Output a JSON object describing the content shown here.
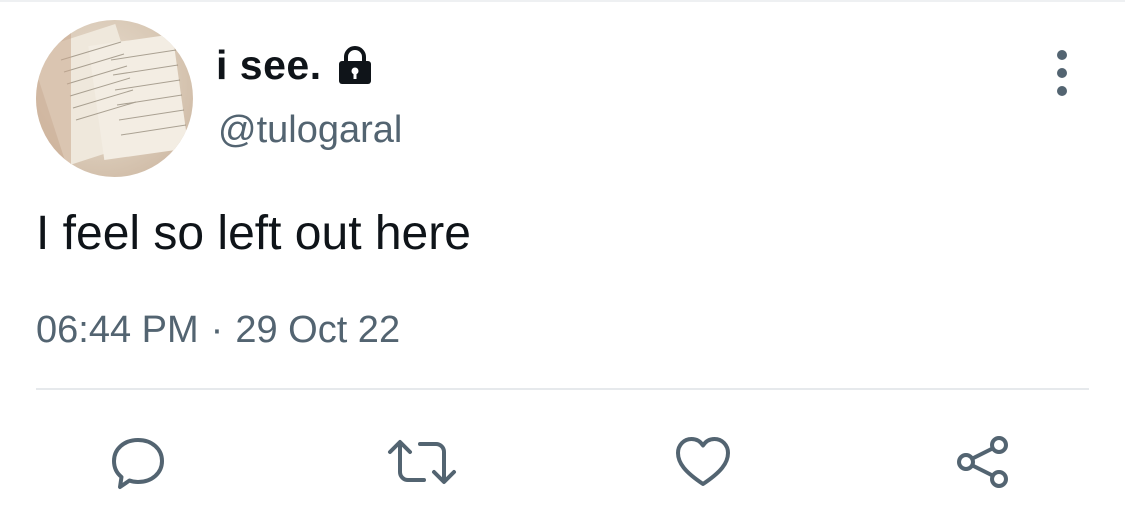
{
  "tweet": {
    "display_name": "i see.",
    "handle": "@tulogaral",
    "text": "I feel so left out here",
    "time": "06:44 PM",
    "separator": "·",
    "date": "29 Oct 22"
  },
  "icons": {
    "lock": "lock-icon",
    "more": "more-vertical-icon",
    "reply": "reply-icon",
    "retweet": "retweet-icon",
    "like": "heart-icon",
    "share": "share-icon"
  },
  "colors": {
    "text_primary": "#0f1419",
    "text_secondary": "#536471",
    "icon": "#536471",
    "divider": "#e6e9ec"
  }
}
